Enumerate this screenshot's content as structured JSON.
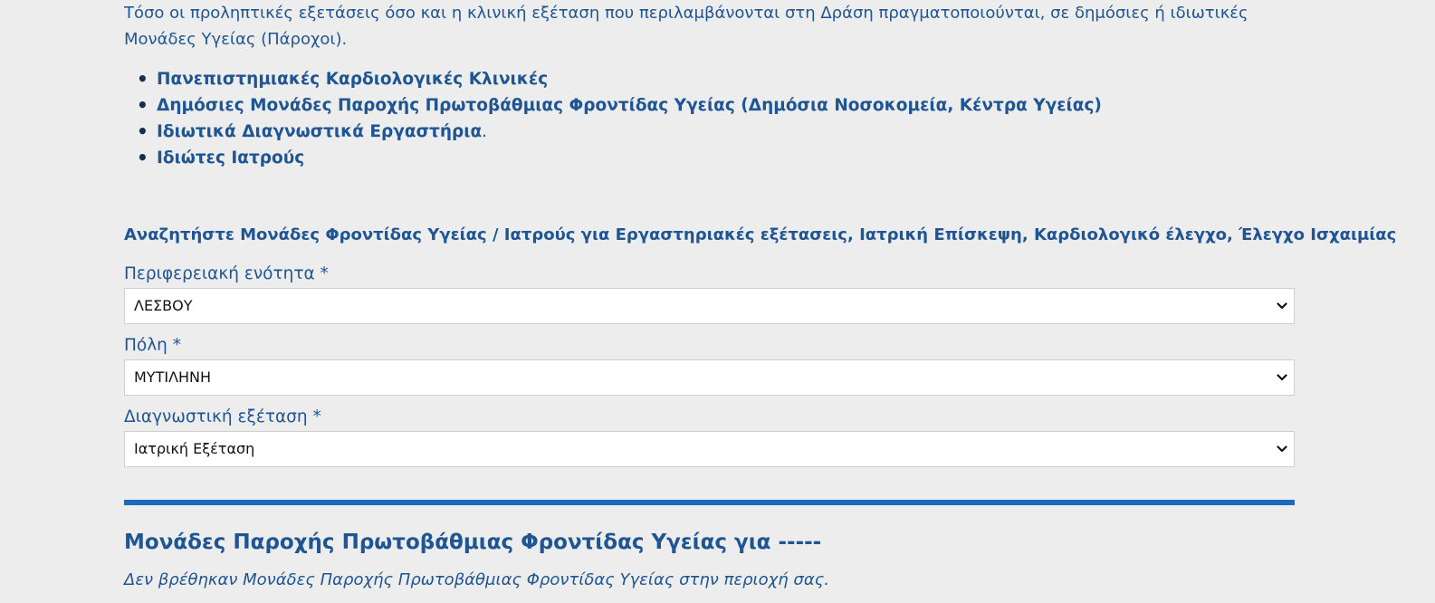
{
  "intro": {
    "text": "Τόσο οι προληπτικές εξετάσεις όσο και η κλινική εξέταση που περιλαμβάνονται στη Δράση πραγματοποιούνται, σε δημόσιες ή ιδιωτικές Μονάδες Υγείας (Πάροχοι)."
  },
  "providers": [
    {
      "label": "Πανεπιστημιακές Καρδιολογικές Κλινικές",
      "trail": ""
    },
    {
      "label": "Δημόσιες Μονάδες Παροχής Πρωτοβάθμιας Φροντίδας Υγείας (Δημόσια Νοσοκομεία, Κέντρα Υγείας)",
      "trail": ""
    },
    {
      "label": "Ιδιωτικά Διαγνωστικά Εργαστήρια",
      "trail": "."
    },
    {
      "label": "Ιδιώτες Ιατρούς",
      "trail": ""
    }
  ],
  "search": {
    "heading": "Αναζητήστε Μονάδες Φροντίδας Υγείας / Ιατρούς για Εργαστηριακές εξέτασεις, Ιατρική Επίσκεψη, Καρδιολογικό έλεγχο, Έλεγχο Ισχαιμίας",
    "region": {
      "label": "Περιφερειακή ενότητα *",
      "value": "ΛΕΣΒΟΥ"
    },
    "city": {
      "label": "Πόλη *",
      "value": "ΜΥΤΙΛΗΝΗ"
    },
    "exam": {
      "label": "Διαγνωστική εξέταση *",
      "value": "Ιατρική Εξέταση"
    }
  },
  "results": {
    "heading": "Μονάδες Παροχής Πρωτοβάθμιας Φροντίδας Υγείας για -----",
    "empty_message": "Δεν βρέθηκαν Μονάδες Παροχής Πρωτοβάθμιας Φροντίδας Υγείας στην περιοχή σας."
  },
  "colors": {
    "text": "#1f5592",
    "divider": "#1a6abf",
    "background": "#ededed"
  },
  "icons": {
    "select_arrow": "chevron-down-icon"
  }
}
